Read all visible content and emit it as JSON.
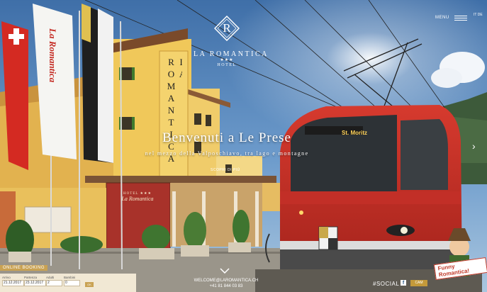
{
  "header": {
    "logo_letter": "R",
    "brand_name": "LA ROMANTICA",
    "brand_stars": "★★★",
    "brand_type": "HOTEL",
    "menu_label": "MENU",
    "languages": "IT  DE"
  },
  "hero": {
    "headline": "Benvenuti a Le Prese",
    "subline": "nel mezzo della Valposchiavo, tra lago e montagne",
    "discover_label": "SCOPRI DI PIÙ",
    "building_sign": "LA ROMANTICA",
    "entrance_sign_hotel": "HOTEL ★★★",
    "entrance_sign_name": "La Romantica",
    "flag_text": "La Romantica",
    "train_destination": "St. Moritz"
  },
  "booking": {
    "tab_label": "ONLINE BOOKING",
    "fields": [
      {
        "label": "Arrivo",
        "value": "21.12.2017"
      },
      {
        "label": "Partenza",
        "value": "23.12.2017"
      },
      {
        "label": "Adulti",
        "value": "2"
      },
      {
        "label": "Bambini",
        "value": "0"
      }
    ],
    "submit_label": "OK"
  },
  "footer": {
    "email": "WELCOME@LAROMANTICA.CH",
    "phone": "+41 81 844 03 83",
    "social_label": "#SOCIAL",
    "fb_label": "f",
    "tripadvisor_label": "CAM"
  },
  "mascot": {
    "label": "Funny Romantica!"
  },
  "colors": {
    "accent_gold": "#c9a253",
    "train_red": "#c8322a",
    "building_yellow": "#e9c45a"
  }
}
